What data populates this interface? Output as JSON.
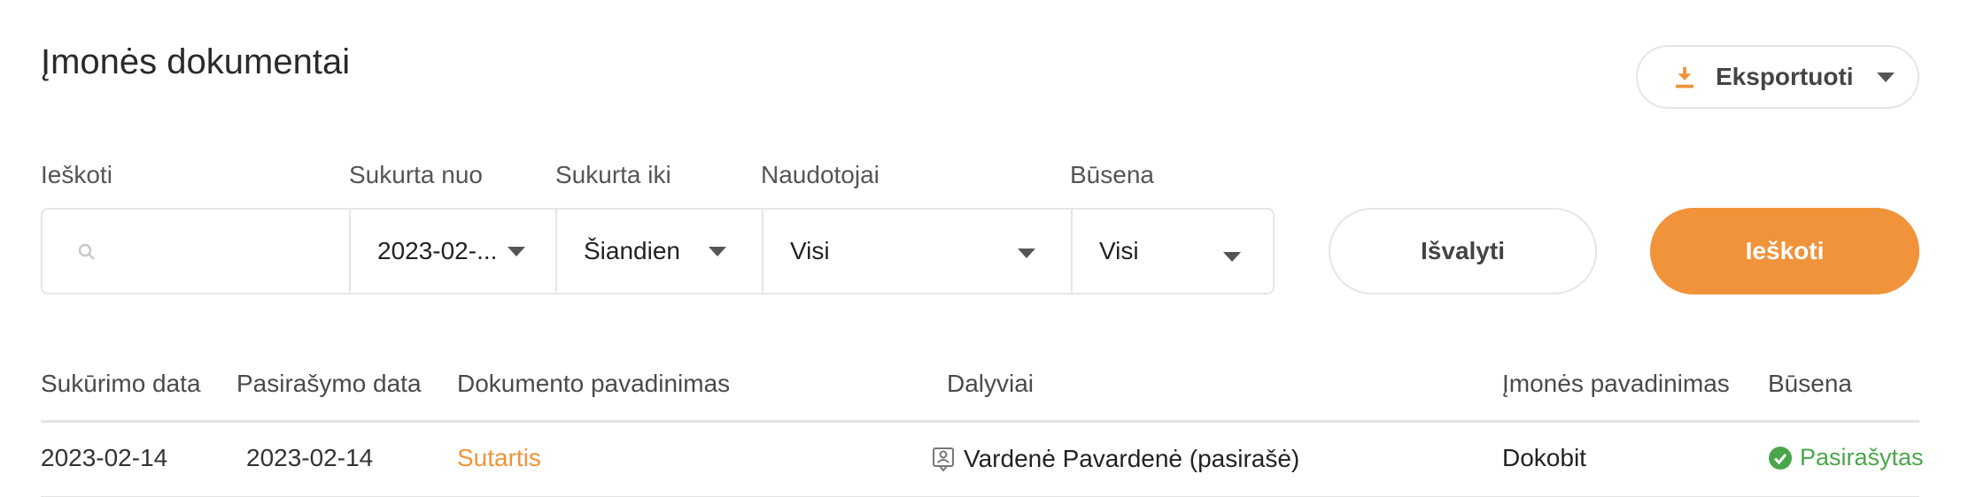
{
  "page": {
    "title": "Įmonės dokumentai"
  },
  "export": {
    "label": "Eksportuoti",
    "icon": "download-icon",
    "accent": "#f0933a"
  },
  "filters": {
    "search": {
      "label": "Ieškoti",
      "value": "",
      "placeholder": ""
    },
    "created_from": {
      "label": "Sukurta nuo",
      "value": "2023-02-..."
    },
    "created_to": {
      "label": "Sukurta iki",
      "value": "Šiandien"
    },
    "users": {
      "label": "Naudotojai",
      "value": "Visi"
    },
    "status": {
      "label": "Būsena",
      "value": "Visi"
    }
  },
  "actions": {
    "clear_label": "Išvalyti",
    "search_label": "Ieškoti",
    "search_color": "#f0933a"
  },
  "table": {
    "columns": [
      "Sukūrimo data",
      "Pasirašymo data",
      "Dokumento pavadinimas",
      "Dalyviai",
      "Įmonės pavadinimas",
      "Būsena"
    ],
    "rows": [
      {
        "created": "2023-02-14",
        "signed": "2023-02-14",
        "document": "Sutartis",
        "participant": "Vardenė Pavardenė (pasirašė)",
        "company": "Dokobit",
        "status": "Pasirašytas",
        "status_color": "#4aa64a"
      }
    ]
  }
}
